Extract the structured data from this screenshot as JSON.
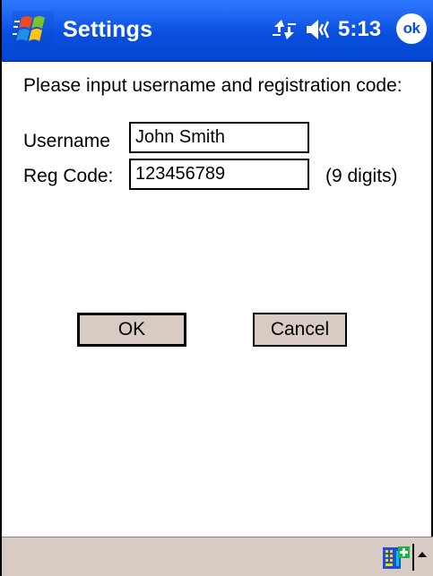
{
  "titlebar": {
    "title": "Settings",
    "time": "5:13",
    "ok_label": "ok",
    "icons": [
      "windows-start-icon",
      "connectivity-icon",
      "speaker-icon"
    ]
  },
  "form": {
    "prompt": "Please input username and registration code:",
    "username_label": "Username",
    "username_value": "John Smith",
    "regcode_label": "Reg Code:",
    "regcode_value": "123456789",
    "regcode_hint": "(9 digits)"
  },
  "buttons": {
    "ok": "OK",
    "cancel": "Cancel"
  },
  "menubar": {
    "icons": [
      "input-panel-icon",
      "input-panel-arrow-icon"
    ]
  },
  "colors": {
    "titlebar": "#0a4fe0",
    "button_face": "#d8cbc3",
    "menubar": "#d8cbc3"
  }
}
